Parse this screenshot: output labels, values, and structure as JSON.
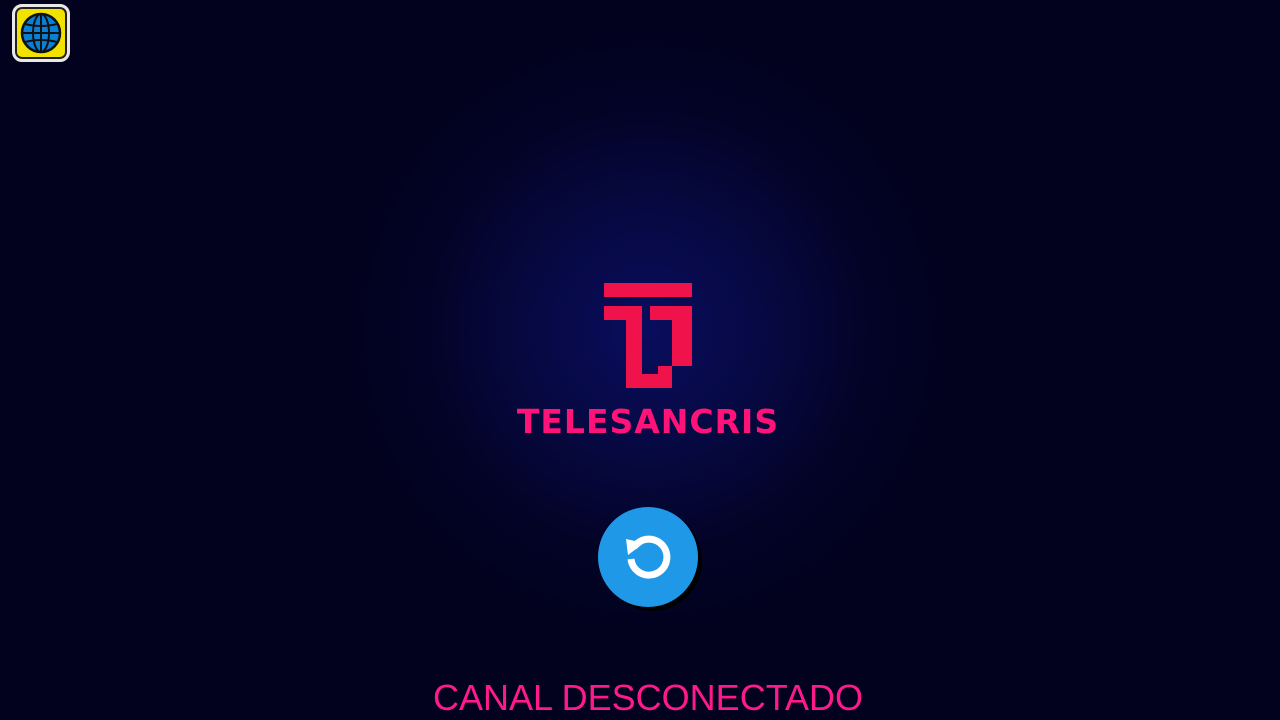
{
  "toolbar": {
    "globe_icon": "globe-icon"
  },
  "channel": {
    "logo_icon": "ts-logo-icon",
    "name": "TELESANCRIS"
  },
  "actions": {
    "reload_icon": "reload-icon"
  },
  "status": {
    "message": "CANAL DESCONECTADO"
  },
  "colors": {
    "background": "#02021f",
    "brand": "#ff1378",
    "logo_red": "#f0124a",
    "reload_button": "#1f98e8",
    "globe_bg": "#f2e200"
  }
}
